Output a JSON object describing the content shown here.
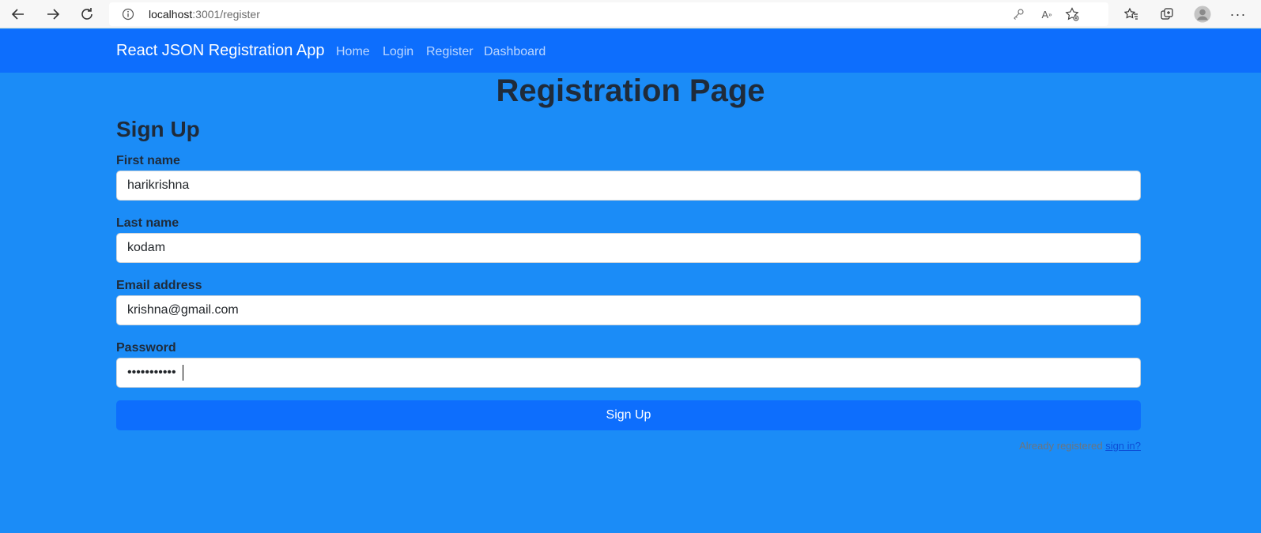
{
  "browser": {
    "url_host": "localhost",
    "url_path": ":3001/register"
  },
  "navbar": {
    "brand": "React JSON Registration App",
    "links": [
      "Home",
      "Login",
      "Register",
      "Dashboard"
    ]
  },
  "page": {
    "title": "Registration Page",
    "form_title": "Sign Up"
  },
  "form": {
    "first_name": {
      "label": "First name",
      "value": "harikrishna"
    },
    "last_name": {
      "label": "Last name",
      "value": "kodam"
    },
    "email": {
      "label": "Email address",
      "value": "krishna@gmail.com"
    },
    "password": {
      "label": "Password",
      "value": "•••••••••••"
    },
    "submit_label": "Sign Up",
    "already_text": "Already registered",
    "sign_in_link": "sign in?"
  },
  "colors": {
    "page_background": "#1b8cf7",
    "navbar": "#0d6efd",
    "button": "#0d6efd"
  }
}
